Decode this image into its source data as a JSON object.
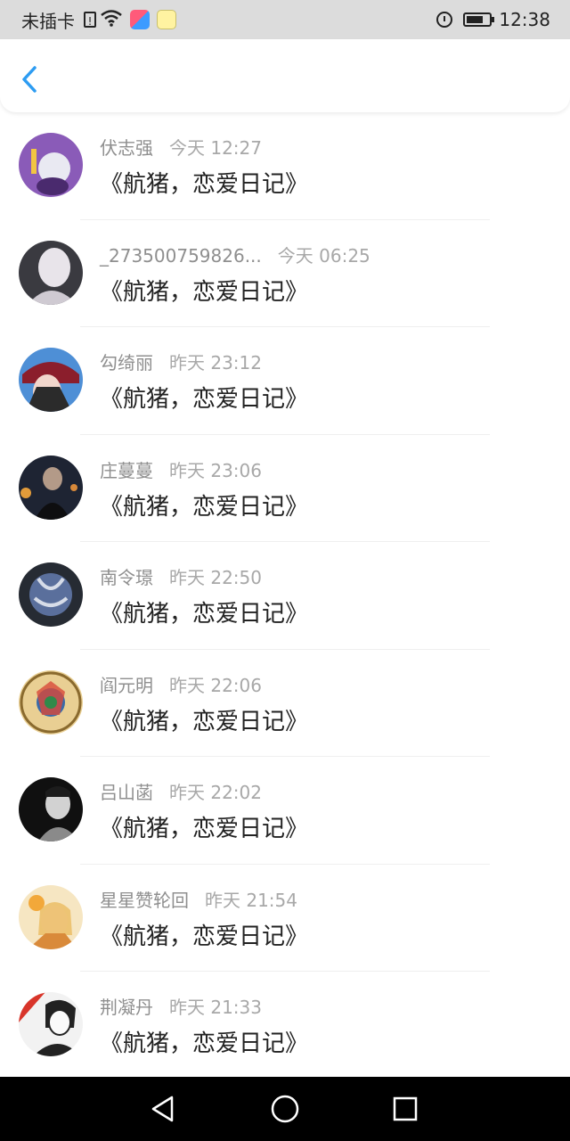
{
  "status_bar": {
    "carrier": "未插卡",
    "time": "12:38",
    "icons": [
      "sim-alert-icon",
      "wifi-icon",
      "app-colorful-icon",
      "app-lemon-icon",
      "alarm-icon",
      "battery-icon"
    ]
  },
  "header": {
    "back_icon": "chevron-left-icon",
    "accent": "#2d9cf2"
  },
  "messages": [
    {
      "name": "伏志强",
      "time": "今天 12:27",
      "text": "《航猪，恋爱日记》"
    },
    {
      "name": "_273500759826...",
      "time": "今天 06:25",
      "text": "《航猪，恋爱日记》"
    },
    {
      "name": "勾绮丽",
      "time": "昨天 23:12",
      "text": "《航猪，恋爱日记》"
    },
    {
      "name": "庄蔓蔓",
      "time": "昨天 23:06",
      "text": "《航猪，恋爱日记》"
    },
    {
      "name": "南令璟",
      "time": "昨天 22:50",
      "text": "《航猪，恋爱日记》"
    },
    {
      "name": "阎元明",
      "time": "昨天 22:06",
      "text": "《航猪，恋爱日记》"
    },
    {
      "name": "吕山菡",
      "time": "昨天 22:02",
      "text": "《航猪，恋爱日记》"
    },
    {
      "name": "星星赞轮回",
      "time": "昨天 21:54",
      "text": "《航猪，恋爱日记》"
    },
    {
      "name": "荆凝丹",
      "time": "昨天 21:33",
      "text": "《航猪，恋爱日记》"
    }
  ],
  "nav_bar": {
    "icons": [
      "back-triangle-icon",
      "home-circle-icon",
      "recents-square-icon"
    ]
  }
}
